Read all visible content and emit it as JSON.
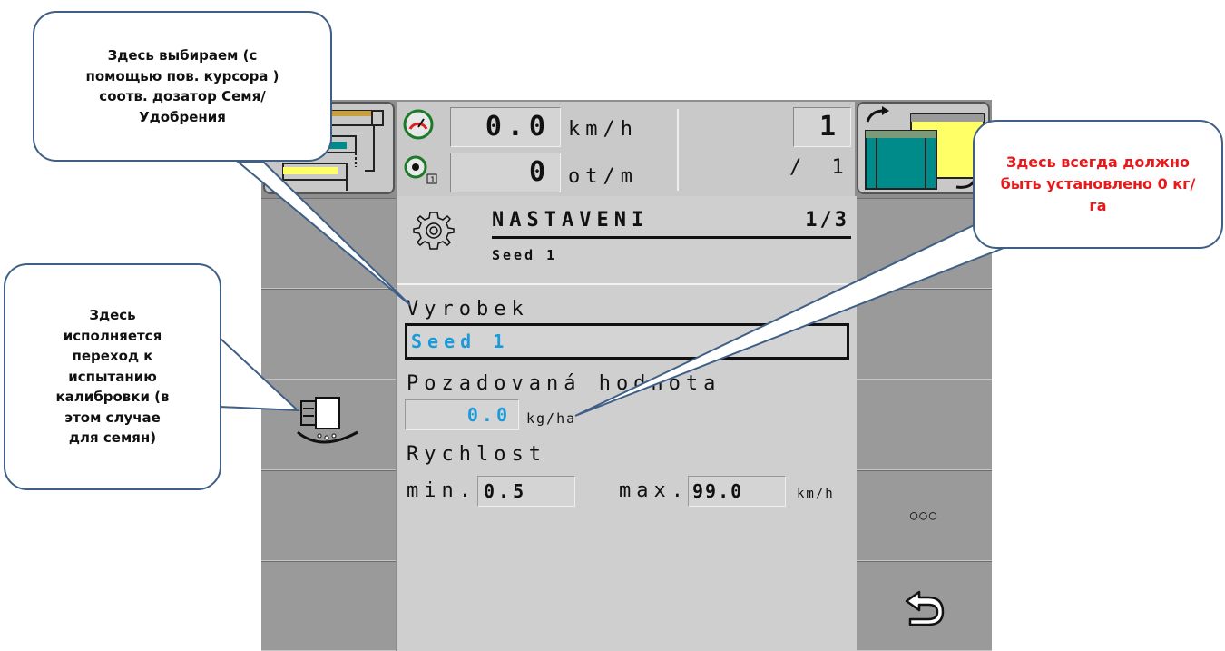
{
  "status": {
    "speed_value": "0.0",
    "speed_unit": "km/h",
    "rpm_value": "0",
    "rpm_unit": "ot/m",
    "counter_value": "1",
    "counter_total": "/ 1"
  },
  "screen": {
    "title": "NASTAVENI",
    "page": "1/3",
    "subtitle": "Seed 1",
    "product_label": "Vyrobek",
    "product_value": "Seed 1",
    "target_label": "Pozadovaná hodnota",
    "target_value": "0.0",
    "target_unit": "kg/ha",
    "speed_label": "Rychlost",
    "min_label": "min.",
    "min_value": "0.5",
    "max_label": "max.",
    "max_value": "99.0",
    "speed_range_unit": "km/h"
  },
  "softkeys": {
    "more_label": "○○○"
  },
  "callouts": {
    "top": "Здесь выбираем (с помощью пов. курсора ) соотв. дозатор Семя/Удобрения",
    "left": "Здесь исполняется переход к испытанию калибровки (в этом случае для семян)",
    "right": "Здесь всегда должно быть установлено 0 кг/га"
  },
  "colors": {
    "accent_value": "#1a9ad6",
    "callout_border": "#3f5f86",
    "callout_right_text": "#e8191b",
    "teal": "#008b8b",
    "yellow": "#ffff66"
  }
}
